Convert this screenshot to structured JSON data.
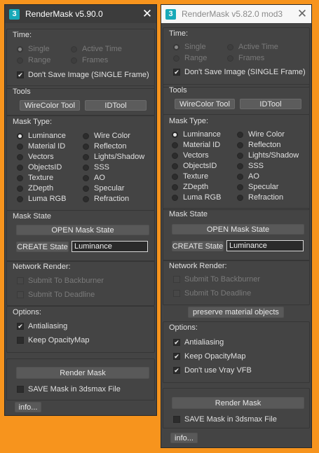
{
  "win1": {
    "title": "RenderMask v5.90.0",
    "time_label": "Time:",
    "time_single": "Single",
    "time_active": "Active Time",
    "time_range": "Range",
    "time_frames": "Frames",
    "dont_save": "Don't Save Image (SINGLE Frame)",
    "tools_label": "Tools",
    "wirecolor_tool": "WireColor Tool",
    "id_tool": "IDTool",
    "mask_type_label": "Mask Type:",
    "mask_left": [
      "Luminance",
      "Material ID",
      "Vectors",
      "ObjectsID",
      "Texture",
      "ZDepth",
      "Luma RGB"
    ],
    "mask_right": [
      "Wire Color",
      "Reflecton",
      "Lights/Shadow",
      "SSS",
      "AO",
      "Specular",
      "Refraction"
    ],
    "mask_state_label": "Mask State",
    "open_mask_state": "OPEN Mask State",
    "create_state": "CREATE State",
    "state_value": "Luminance",
    "network_label": "Network Render:",
    "submit_backburner": "Submit To Backburner",
    "submit_deadline": "Submit To Deadline",
    "options_label": "Options:",
    "antialiasing": "Antialiasing",
    "keep_opacity": "Keep OpacityMap",
    "render_mask": "Render Mask",
    "save_mask": "SAVE Mask in 3dsmax File",
    "info": "info..."
  },
  "win2": {
    "title": "RenderMask v5.82.0 mod3",
    "time_label": "Time:",
    "time_single": "Single",
    "time_active": "Active Time",
    "time_range": "Range",
    "time_frames": "Frames",
    "dont_save": "Don't Save Image (SINGLE Frame)",
    "tools_label": "Tools",
    "wirecolor_tool": "WireColor Tool",
    "id_tool": "IDTool",
    "mask_type_label": "Mask Type:",
    "mask_left": [
      "Luminance",
      "Material ID",
      "Vectors",
      "ObjectsID",
      "Texture",
      "ZDepth",
      "Luma RGB"
    ],
    "mask_right": [
      "Wire Color",
      "Reflecton",
      "Lights/Shadow",
      "SSS",
      "AO",
      "Specular",
      "Refraction"
    ],
    "mask_state_label": "Mask State",
    "open_mask_state": "OPEN Mask State",
    "create_state": "CREATE State",
    "state_value": "Luminance",
    "network_label": "Network Render:",
    "submit_backburner": "Submit To Backburner",
    "submit_deadline": "Submit To Deadline",
    "preserve_material": "preserve material objects",
    "options_label": "Options:",
    "antialiasing": "Antialiasing",
    "keep_opacity": "Keep OpacityMap",
    "dont_use_vray": "Don't use Vray VFB",
    "render_mask": "Render Mask",
    "save_mask": "SAVE Mask in 3dsmax File",
    "info": "info..."
  },
  "icons": {
    "app": "3dsmax-icon",
    "close": "close-icon",
    "check": "check-icon"
  },
  "colors": {
    "background": "#f7941d",
    "panel": "#444444",
    "app_icon": "#17a9b8"
  },
  "app_icon_glyph": "3",
  "close_glyph": "✕",
  "check_glyph": "✔"
}
